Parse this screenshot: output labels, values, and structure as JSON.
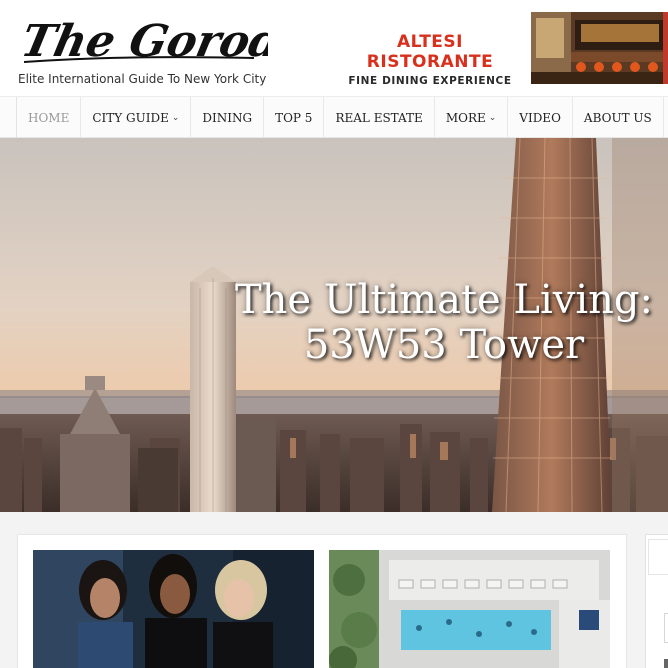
{
  "site": {
    "logo_text": "The Gorod",
    "tagline": "Elite International Guide To New York City"
  },
  "ad": {
    "title": "ALTESI RISTORANTE",
    "subtitle": "FINE DINING EXPERIENCE"
  },
  "nav": {
    "items": [
      {
        "label": "HOME",
        "active": true
      },
      {
        "label": "CITY GUIDE",
        "dropdown": true
      },
      {
        "label": "DINING"
      },
      {
        "label": "TOP 5"
      },
      {
        "label": "REAL ESTATE"
      },
      {
        "label": "MORE",
        "dropdown": true
      },
      {
        "label": "VIDEO"
      },
      {
        "label": "ABOUT US"
      }
    ],
    "dropdown_icon": "chevron-down-icon"
  },
  "hero": {
    "title_line1": "The Ultimate Living:",
    "title_line2": "53W53 Tower"
  },
  "colors": {
    "ad_red": "#d8301c",
    "nav_active": "#999999"
  }
}
